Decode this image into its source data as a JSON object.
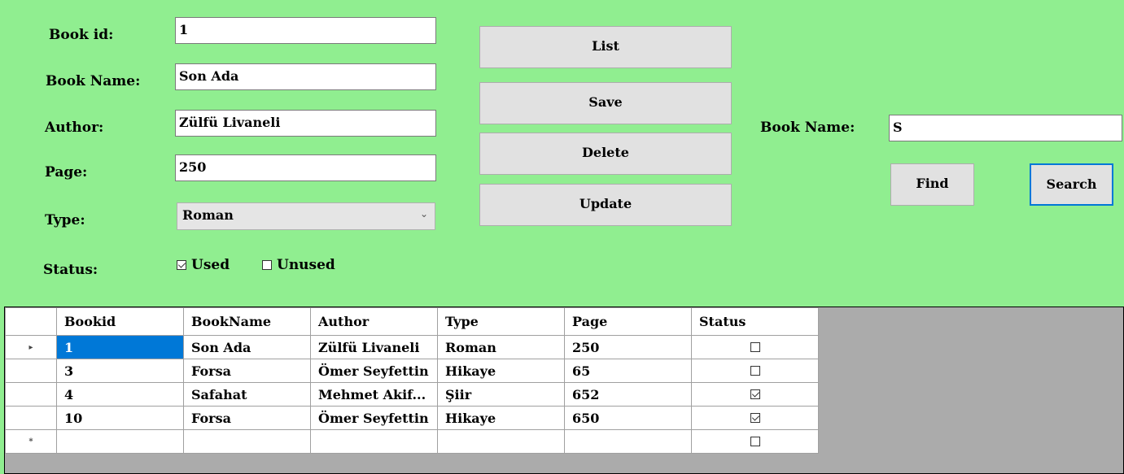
{
  "form": {
    "book_id_label": "Book id:",
    "book_id_value": "1",
    "book_name_label": "Book Name:",
    "book_name_value": "Son Ada",
    "author_label": "Author:",
    "author_value": "Zülfü Livaneli",
    "page_label": "Page:",
    "page_value": "250",
    "type_label": "Type:",
    "type_value": "Roman",
    "status_label": "Status:",
    "used_label": "Used",
    "used_checked": true,
    "unused_label": "Unused",
    "unused_checked": false
  },
  "actions": {
    "list": "List",
    "save": "Save",
    "delete": "Delete",
    "update": "Update"
  },
  "search": {
    "book_name_label": "Book Name:",
    "book_name_value": "S",
    "find": "Find",
    "search": "Search"
  },
  "grid": {
    "columns": [
      "Bookid",
      "BookName",
      "Author",
      "Type",
      "Page",
      "Status"
    ],
    "rows": [
      {
        "bookid": "1",
        "bookname": "Son Ada",
        "author": "Zülfü Livaneli",
        "type": "Roman",
        "page": "250",
        "status": false
      },
      {
        "bookid": "3",
        "bookname": "Forsa",
        "author": "Ömer Seyfettin",
        "type": "Hikaye",
        "page": "65",
        "status": false
      },
      {
        "bookid": "4",
        "bookname": "Safahat",
        "author": "Mehmet Akif...",
        "type": "Şiir",
        "page": "652",
        "status": true
      },
      {
        "bookid": "10",
        "bookname": "Forsa",
        "author": "Ömer Seyfettin",
        "type": "Hikaye",
        "page": "650",
        "status": true
      }
    ],
    "current_row_marker": "▸",
    "new_row_marker": "*"
  }
}
